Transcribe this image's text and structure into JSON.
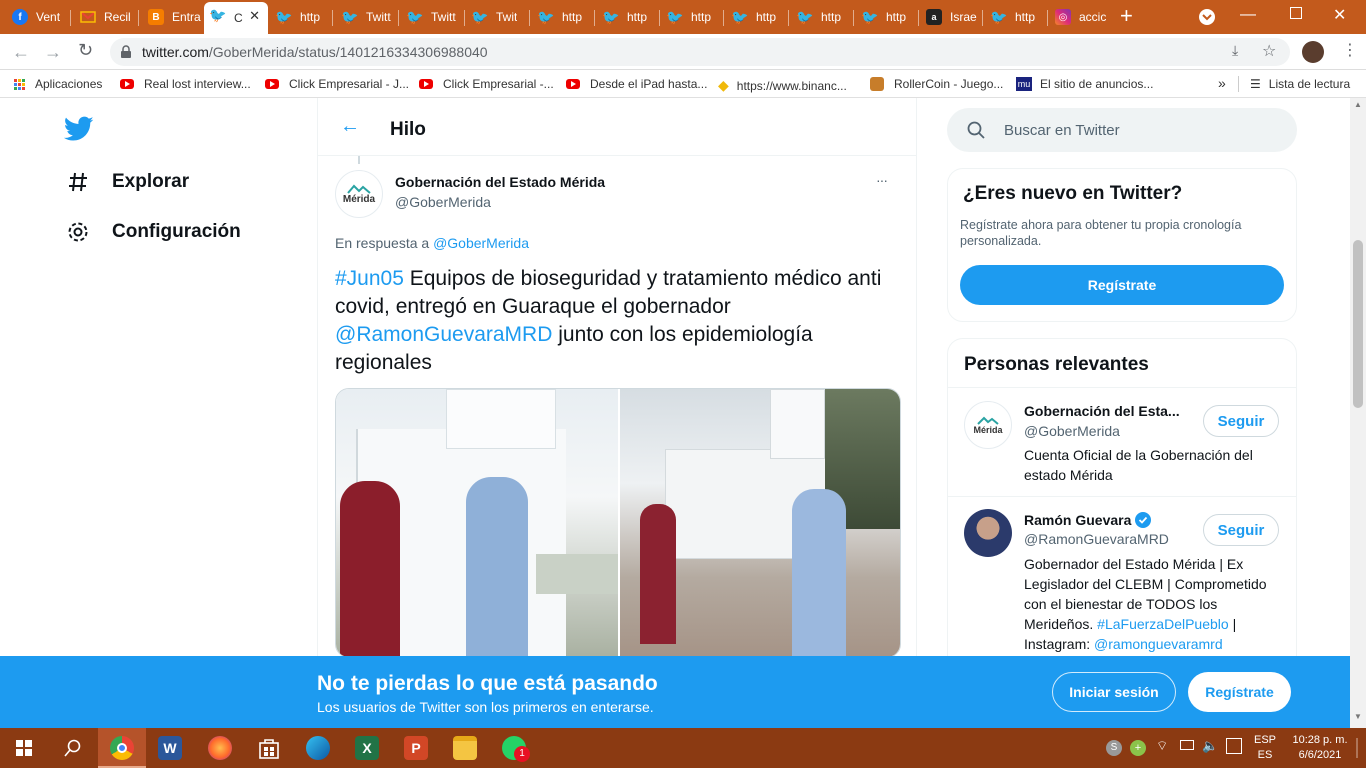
{
  "browser": {
    "tabs": [
      {
        "label": "Vent",
        "icon": "facebook-icon"
      },
      {
        "label": "Recil",
        "icon": "gmail-icon"
      },
      {
        "label": "Entra",
        "icon": "blogger-icon"
      },
      {
        "label": "C",
        "icon": "twitter-icon",
        "active": true
      },
      {
        "label": "http",
        "icon": "twitter-icon"
      },
      {
        "label": "Twitt",
        "icon": "twitter-icon"
      },
      {
        "label": "Twitt",
        "icon": "twitter-icon"
      },
      {
        "label": "Twit",
        "icon": "twitter-icon"
      },
      {
        "label": "http",
        "icon": "twitter-icon"
      },
      {
        "label": "http",
        "icon": "twitter-icon"
      },
      {
        "label": "http",
        "icon": "twitter-icon"
      },
      {
        "label": "http",
        "icon": "twitter-icon"
      },
      {
        "label": "http",
        "icon": "twitter-icon"
      },
      {
        "label": "http",
        "icon": "twitter-icon"
      },
      {
        "label": "Israe",
        "icon": "abc-icon"
      },
      {
        "label": "http",
        "icon": "twitter-icon"
      },
      {
        "label": "accic",
        "icon": "instagram-icon"
      }
    ],
    "url_domain": "twitter.com",
    "url_path": "/GoberMerida/status/1401216334306988040",
    "bookmarks": [
      {
        "label": "Aplicaciones",
        "icon": "apps-grid-icon"
      },
      {
        "label": "Real lost interview...",
        "icon": "youtube-icon"
      },
      {
        "label": "Click Empresarial - J...",
        "icon": "youtube-icon"
      },
      {
        "label": "Click Empresarial -...",
        "icon": "youtube-icon"
      },
      {
        "label": "Desde el iPad hasta...",
        "icon": "youtube-icon"
      },
      {
        "label": "https://www.binanc...",
        "icon": "binance-icon"
      },
      {
        "label": "RollerCoin - Juego...",
        "icon": "rollercoin-icon"
      },
      {
        "label": "El sitio de anuncios...",
        "icon": "mu-icon"
      }
    ],
    "reading_list": "Lista de lectura",
    "more": "»"
  },
  "nav": {
    "explore": "Explorar",
    "settings": "Configuración"
  },
  "thread": {
    "header": "Hilo",
    "author_name": "Gobernación del Estado Mérida",
    "author_handle": "@GoberMerida",
    "avatar_text": "Mérida",
    "reply_prefix": "En respuesta a",
    "reply_to": "@GoberMerida",
    "hashtag": "#Jun05",
    "text_1": " Equipos de bioseguridad y tratamiento médico anti covid, entregó en Guaraque el gobernador ",
    "mention": "@RamonGuevaraMRD",
    "text_2": " junto con los epidemiología regionales",
    "more": "···"
  },
  "sidebar": {
    "search_placeholder": "Buscar en Twitter",
    "new_title": "¿Eres nuevo en Twitter?",
    "new_desc": "Regístrate ahora para obtener tu propia cronología personalizada.",
    "signup": "Regístrate",
    "relevant_title": "Personas relevantes",
    "people": [
      {
        "name": "Gobernación del Esta...",
        "handle": "@GoberMerida",
        "follow": "Seguir",
        "bio": "Cuenta Oficial de la Gobernación del estado Mérida"
      },
      {
        "name": "Ramón Guevara",
        "handle": "@RamonGuevaraMRD",
        "follow": "Seguir",
        "bio_1": "Gobernador del Estado Mérida | Ex Legislador del CLEBM | Comprometido con el bienestar de TODOS los Merideños. ",
        "bio_tag": "#LaFuerzaDelPueblo",
        "bio_2": " | Instagram: ",
        "bio_ig": "@ramonguevaramrd"
      }
    ]
  },
  "banner": {
    "title": "No te pierdas lo que está pasando",
    "subtitle": "Los usuarios de Twitter son los primeros en enterarse.",
    "login": "Iniciar sesión",
    "signup": "Regístrate"
  },
  "taskbar": {
    "lang_1": "ESP",
    "lang_2": "ES",
    "time": "10:28 p. m.",
    "date": "6/6/2021",
    "whatsapp_badge": "1"
  },
  "colors": {
    "twitter_blue": "#1d9bf0",
    "chrome_frame": "#c35a1c",
    "taskbar": "#8b3a12"
  }
}
